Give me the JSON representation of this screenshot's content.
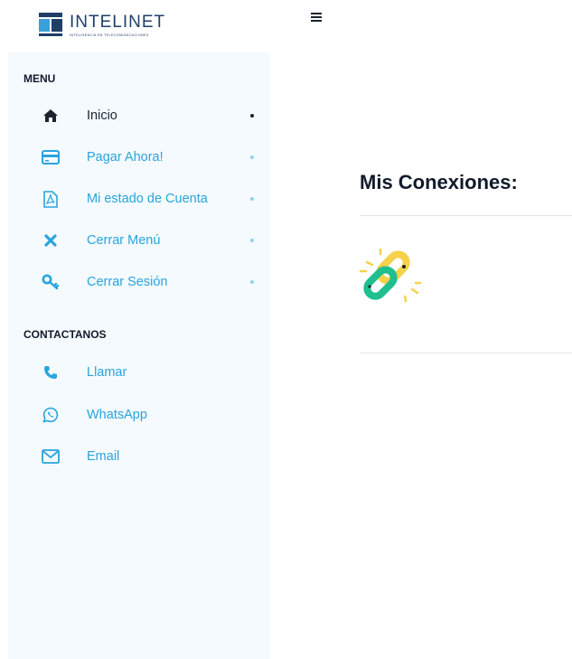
{
  "header": {
    "logo_name": "INTELINET",
    "logo_tagline": "INTELIGENCIA EN TELECOMUNICACIONES",
    "menu_icon": "hamburger-icon"
  },
  "sidebar": {
    "menu_title": "MENU",
    "menu_items": [
      {
        "label": "Inicio",
        "icon": "home-icon",
        "active": true
      },
      {
        "label": "Pagar Ahora!",
        "icon": "credit-card-icon",
        "active": false
      },
      {
        "label": "Mi estado de Cuenta",
        "icon": "pdf-file-icon",
        "active": false
      },
      {
        "label": "Cerrar Menú",
        "icon": "close-icon",
        "active": false
      },
      {
        "label": "Cerrar Sesión",
        "icon": "key-icon",
        "active": false
      }
    ],
    "contact_title": "CONTACTANOS",
    "contact_items": [
      {
        "label": "Llamar",
        "icon": "phone-icon"
      },
      {
        "label": "WhatsApp",
        "icon": "whatsapp-icon"
      },
      {
        "label": "Email",
        "icon": "envelope-icon"
      }
    ]
  },
  "main": {
    "title": "Mis Conexiones:",
    "illustration": "chain-link-icon"
  },
  "colors": {
    "accent": "#2aa4dd",
    "sidebar_bg": "#f4fafd",
    "text_dark": "#1c2430",
    "brand_navy": "#1f3f66",
    "link_green": "#1fbf8f",
    "link_yellow": "#f6d24a"
  }
}
